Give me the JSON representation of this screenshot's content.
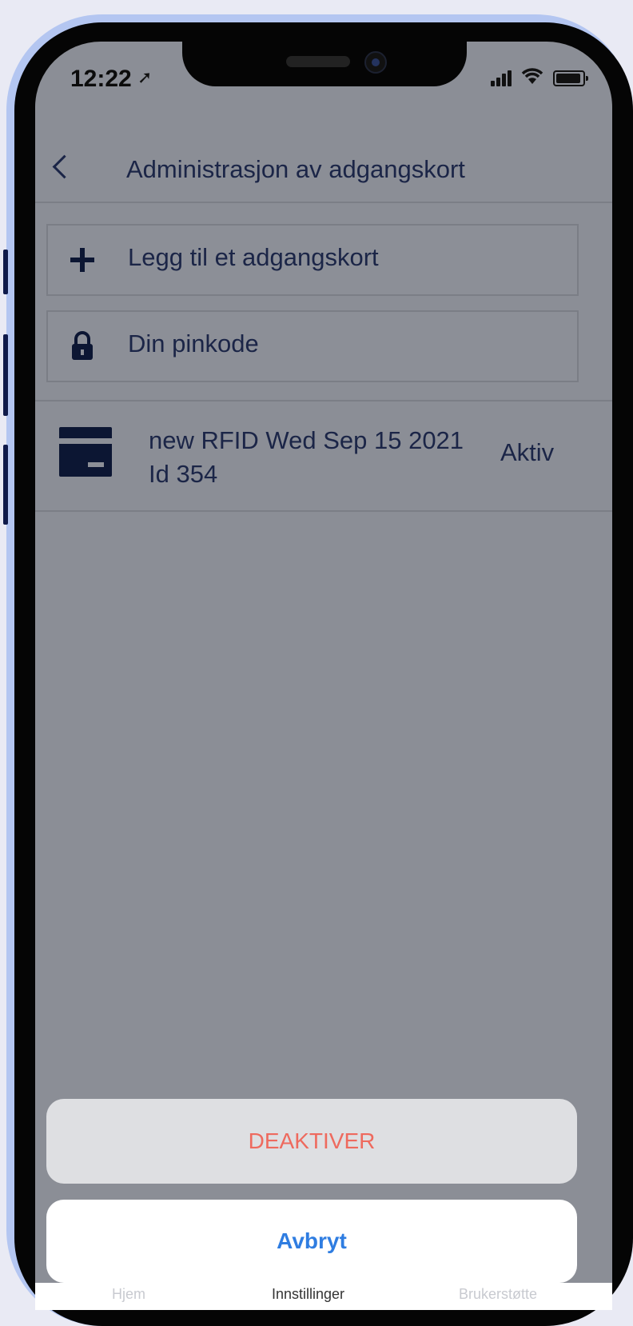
{
  "status_bar": {
    "time": "12:22",
    "location_glyph": "➚"
  },
  "header": {
    "title": "Administrasjon av adgangskort"
  },
  "actions": [
    {
      "label": "Legg til et adgangskort",
      "icon": "plus-icon"
    },
    {
      "label": "Din pinkode",
      "icon": "lock-icon"
    }
  ],
  "card": {
    "title_line1": "new RFID Wed Sep 15 2021",
    "title_line2": "Id 354",
    "status": "Aktiv",
    "icon": "credit-card-icon"
  },
  "sheet": {
    "deactivate_label": "DEAKTIVER",
    "cancel_label": "Avbryt"
  },
  "tabs": [
    {
      "label": "Hjem"
    },
    {
      "label": "Innstillinger"
    },
    {
      "label": "Brukerstøtte"
    }
  ],
  "colors": {
    "dim_overlay_bg": "#8b8e96",
    "text_dark": "#1b2547",
    "destructive": "#ee6a5e",
    "cancel_blue": "#2f7de1",
    "frame_accent": "#b4c6f1"
  }
}
